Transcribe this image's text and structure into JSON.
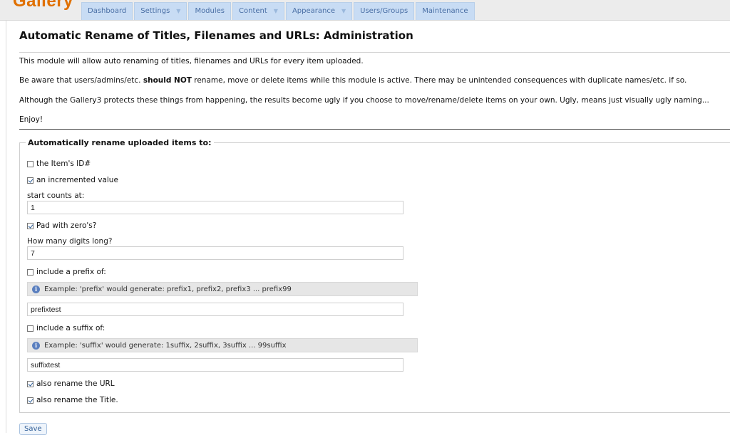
{
  "header": {
    "logo": "Gallery",
    "nav": [
      {
        "label": "Dashboard",
        "dropdown": false
      },
      {
        "label": "Settings",
        "dropdown": true
      },
      {
        "label": "Modules",
        "dropdown": false
      },
      {
        "label": "Content",
        "dropdown": true
      },
      {
        "label": "Appearance",
        "dropdown": true
      },
      {
        "label": "Users/Groups",
        "dropdown": false
      },
      {
        "label": "Maintenance",
        "dropdown": false
      }
    ]
  },
  "page": {
    "title": "Automatic Rename of Titles, Filenames and URLs: Administration",
    "intro1": "This module will allow auto renaming of titles, filenames and URLs for every item uploaded.",
    "intro2_pre": "Be aware that users/admins/etc. ",
    "intro2_bold": "should NOT",
    "intro2_post": " rename, move or delete items while this module is active. There may be unintended consequences with duplicate names/etc. if so.",
    "intro3": "Although the Gallery3 protects these things from happening, the results become ugly if you choose to move/rename/delete items on your own. Ugly, means just visually ugly naming...",
    "intro4": "Enjoy!"
  },
  "form": {
    "legend": "Automatically rename uploaded items to:",
    "item_id": {
      "label": "the Item's ID#",
      "checked": false
    },
    "incremented": {
      "label": "an incremented value",
      "checked": true
    },
    "start_counts": {
      "label": "start counts at:",
      "value": "1"
    },
    "pad_zeros": {
      "label": "Pad with zero's?",
      "checked": true
    },
    "digits": {
      "label": "How many digits long?",
      "value": "7"
    },
    "prefix": {
      "label": "include a prefix of:",
      "checked": false,
      "info": "Example: 'prefix' would generate: prefix1, prefix2, prefix3 ... prefix99",
      "value": "prefixtest"
    },
    "suffix": {
      "label": "include a suffix of:",
      "checked": false,
      "info": "Example: 'suffix' would generate: 1suffix, 2suffix, 3suffix ... 99suffix",
      "value": "suffixtest"
    },
    "rename_url": {
      "label": "also rename the URL",
      "checked": true
    },
    "rename_title": {
      "label": "also rename the Title.",
      "checked": true
    },
    "save_label": "Save"
  }
}
